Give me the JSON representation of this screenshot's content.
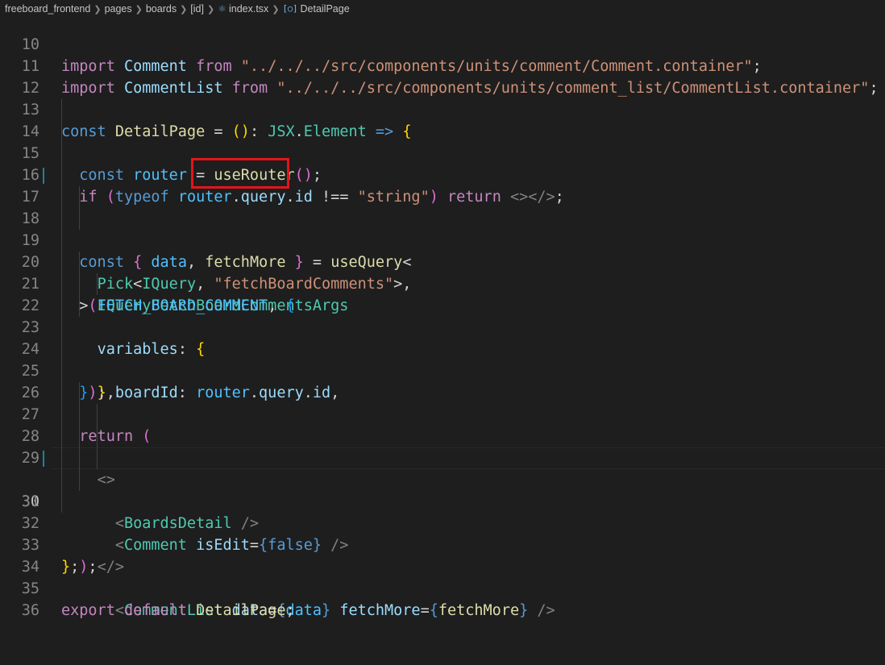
{
  "breadcrumb": {
    "items": [
      "freeboard_frontend",
      "pages",
      "boards",
      "[id]",
      "index.tsx",
      "DetailPage"
    ],
    "file_icon": "react-file-icon",
    "symbol_icon": "symbol-variable-icon"
  },
  "editor": {
    "active_line": 30,
    "highlight_text": "fetchMore",
    "highlight_color": "#e3151a",
    "lines": [
      {
        "n": "10",
        "text": "import Comment from \"../../../src/components/units/comment/Comment.container\";"
      },
      {
        "n": "11",
        "text": "import CommentList from \"../../../src/components/units/comment_list/CommentList.container\";"
      },
      {
        "n": "12",
        "text": ""
      },
      {
        "n": "13",
        "text": "const DetailPage = (): JSX.Element => {"
      },
      {
        "n": "14",
        "text": "  const router = useRouter();"
      },
      {
        "n": "15",
        "text": "  if (typeof router.query.id !== \"string\") return <></>;"
      },
      {
        "n": "16",
        "text": ""
      },
      {
        "n": "17",
        "text": "  const { data, fetchMore } = useQuery<"
      },
      {
        "n": "18",
        "text": "    Pick<IQuery, \"fetchBoardComments\">,"
      },
      {
        "n": "19",
        "text": "    IQueryFetchBoardCommentsArgs"
      },
      {
        "n": "20",
        "text": "  >(FETCH_BOARD_COMMENT, {"
      },
      {
        "n": "21",
        "text": "    variables: {"
      },
      {
        "n": "22",
        "text": "      boardId: router.query.id,"
      },
      {
        "n": "23",
        "text": "    },"
      },
      {
        "n": "24",
        "text": "  });"
      },
      {
        "n": "25",
        "text": ""
      },
      {
        "n": "26",
        "text": "  return ("
      },
      {
        "n": "27",
        "text": "    <>"
      },
      {
        "n": "28",
        "text": "      <BoardsDetail />"
      },
      {
        "n": "29",
        "text": "      <Comment isEdit={false} />"
      },
      {
        "n": "30",
        "text": "      <CommentList data={data} fetchMore={fetchMore} />"
      },
      {
        "n": "31",
        "text": "    </>"
      },
      {
        "n": "32",
        "text": "  );"
      },
      {
        "n": "33",
        "text": "};"
      },
      {
        "n": "34",
        "text": ""
      },
      {
        "n": "35",
        "text": "export default DetailPage;"
      },
      {
        "n": "36",
        "text": ""
      }
    ]
  }
}
